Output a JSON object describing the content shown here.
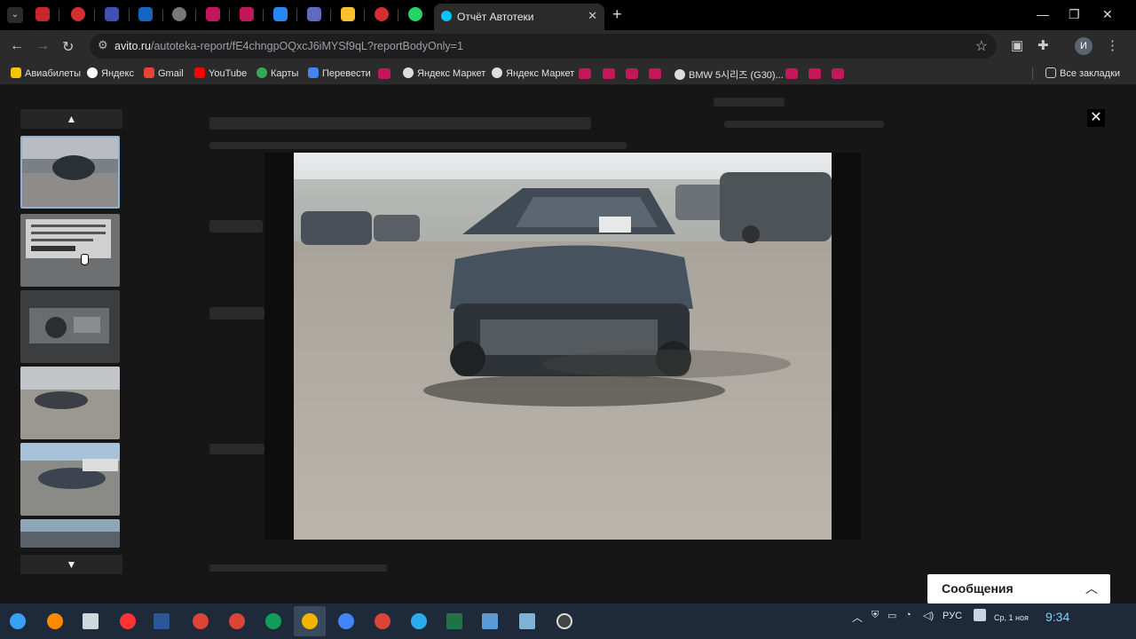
{
  "browser": {
    "active_tab_title": "Отчёт Автотеки",
    "url_domain": "avito.ru",
    "url_path": "/autoteka-report/fE4chngpOQxcJ6iMYSf9qL?reportBodyOnly=1",
    "profile_initial": "И"
  },
  "bookmarks": [
    {
      "label": "Авиабилеты",
      "color": "#f5c400"
    },
    {
      "label": "Яндекс",
      "color": "#ffffff"
    },
    {
      "label": "Gmail",
      "color": "#ea4335"
    },
    {
      "label": "YouTube",
      "color": "#ff0000"
    },
    {
      "label": "Карты",
      "color": "#34a853"
    },
    {
      "label": "Перевести",
      "color": "#4285f4"
    },
    {
      "label": "Яндекс Маркет",
      "color": "#dddddd"
    },
    {
      "label": "Яндекс Маркет",
      "color": "#dddddd"
    },
    {
      "label": "BMW 5시리즈 (G30)...",
      "color": "#dddddd"
    }
  ],
  "all_bookmarks_label": "Все закладки",
  "viewer": {
    "close_icon": "close-icon",
    "thumb_count_visible": 6
  },
  "messages_widget": {
    "label": "Сообщения"
  },
  "taskbar": {
    "language": "РУС",
    "time": "9:34",
    "date": "Ср, 1 ноя",
    "apps": [
      {
        "name": "start",
        "color": "#38a1f3"
      },
      {
        "name": "search",
        "color": "#ff8a00"
      },
      {
        "name": "notepad",
        "color": "#cfd8dc"
      },
      {
        "name": "yandex",
        "color": "#ff3333"
      },
      {
        "name": "word",
        "color": "#2b579a"
      },
      {
        "name": "chrome",
        "color": "#db4437"
      },
      {
        "name": "chrome",
        "color": "#db4437"
      },
      {
        "name": "chrome",
        "color": "#0f9d58"
      },
      {
        "name": "chrome",
        "color": "#f4b400"
      },
      {
        "name": "chrome",
        "color": "#4285f4"
      },
      {
        "name": "chrome",
        "color": "#db4437"
      },
      {
        "name": "telegram",
        "color": "#2aabee"
      },
      {
        "name": "excel",
        "color": "#217346"
      },
      {
        "name": "photos",
        "color": "#5b9bd5"
      },
      {
        "name": "screenshot",
        "color": "#7fb3d5"
      },
      {
        "name": "obs",
        "color": "#444444"
      }
    ]
  }
}
